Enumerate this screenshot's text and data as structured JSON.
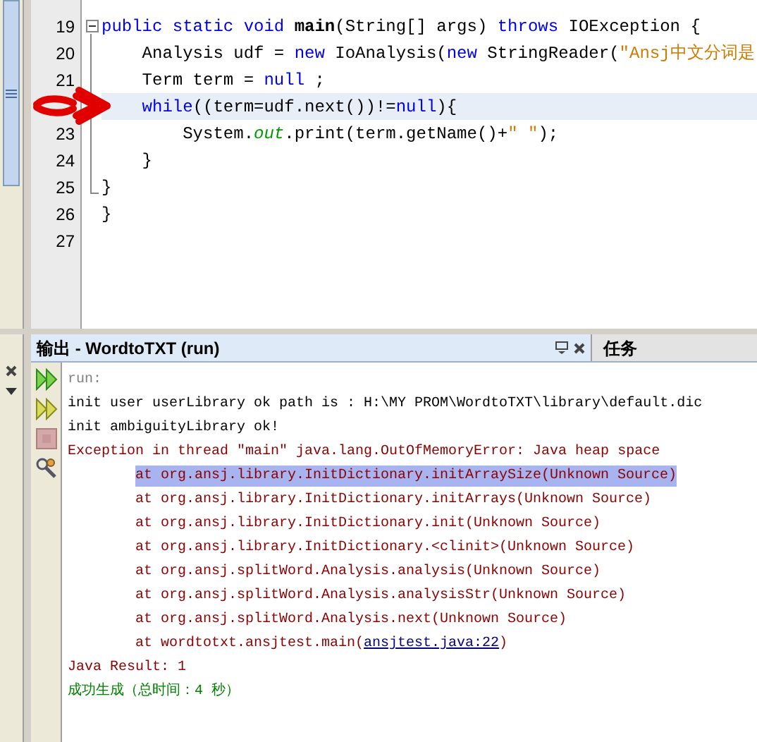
{
  "editor": {
    "lines": [
      {
        "number": "19",
        "collapsed_marker": true,
        "highlighted": false,
        "tokens": [
          {
            "kind": "keyword",
            "text": "public static void "
          },
          {
            "kind": "bold",
            "text": "main"
          },
          {
            "kind": "plain",
            "text": "(String[] args) "
          },
          {
            "kind": "keyword",
            "text": "throws"
          },
          {
            "kind": "plain",
            "text": " IOException {"
          }
        ]
      },
      {
        "number": "20",
        "collapsed_marker": false,
        "highlighted": false,
        "tokens": [
          {
            "kind": "plain",
            "text": "    Analysis udf = "
          },
          {
            "kind": "keyword",
            "text": "new"
          },
          {
            "kind": "plain",
            "text": " IoAnalysis("
          },
          {
            "kind": "keyword",
            "text": "new"
          },
          {
            "kind": "plain",
            "text": " StringReader("
          },
          {
            "kind": "string",
            "text": "\"Ansj中文分词是"
          }
        ]
      },
      {
        "number": "21",
        "collapsed_marker": false,
        "highlighted": false,
        "tokens": [
          {
            "kind": "plain",
            "text": "    Term term = "
          },
          {
            "kind": "keyword",
            "text": "null"
          },
          {
            "kind": "plain",
            "text": " ;"
          }
        ]
      },
      {
        "collapsed_marker": false,
        "highlighted": true,
        "tokens": [
          {
            "kind": "keyword",
            "text": "    while"
          },
          {
            "kind": "plain",
            "text": "((term=udf.next())!="
          },
          {
            "kind": "keyword",
            "text": "null"
          },
          {
            "kind": "plain",
            "text": "){"
          }
        ]
      },
      {
        "number": "23",
        "collapsed_marker": false,
        "highlighted": false,
        "tokens": [
          {
            "kind": "plain",
            "text": "        System."
          },
          {
            "kind": "field",
            "text": "out"
          },
          {
            "kind": "plain",
            "text": ".print(term.getName()+"
          },
          {
            "kind": "string",
            "text": "\" \""
          },
          {
            "kind": "plain",
            "text": ");"
          }
        ]
      },
      {
        "number": "24",
        "collapsed_marker": false,
        "highlighted": false,
        "tokens": [
          {
            "kind": "plain",
            "text": "    }"
          }
        ]
      },
      {
        "number": "25",
        "collapsed_marker": false,
        "highlighted": false,
        "tokens": [
          {
            "kind": "plain",
            "text": "}"
          }
        ]
      },
      {
        "number": "26",
        "collapsed_marker": false,
        "highlighted": false,
        "tokens": [
          {
            "kind": "plain",
            "text": "}"
          }
        ]
      },
      {
        "number": "27",
        "collapsed_marker": false,
        "highlighted": false
      }
    ]
  },
  "output_panel": {
    "title": "输出 - WordtoTXT (run)",
    "side_tab": "任务",
    "lines": [
      {
        "kind": "muted",
        "indented": false,
        "selected": false,
        "segments": [
          {
            "text": "run:",
            "link": false
          }
        ]
      },
      {
        "kind": "normal",
        "indented": false,
        "selected": false,
        "segments": [
          {
            "text": "init user userLibrary ok path is : H:\\MY PROM\\WordtoTXT\\library\\default.dic",
            "link": false
          }
        ]
      },
      {
        "kind": "normal",
        "indented": false,
        "selected": false,
        "segments": [
          {
            "text": "init ambiguityLibrary ok!",
            "link": false
          }
        ]
      },
      {
        "kind": "error",
        "indented": false,
        "selected": false,
        "segments": [
          {
            "text": "Exception in thread \"main\" java.lang.OutOfMemoryError: Java heap space",
            "link": false
          }
        ]
      },
      {
        "kind": "error",
        "indented": true,
        "selected": true,
        "segments": [
          {
            "text": "at org.ansj.library.InitDictionary.initArraySize(Unknown Source)",
            "link": false
          }
        ]
      },
      {
        "kind": "error",
        "indented": true,
        "selected": false,
        "segments": [
          {
            "text": "at org.ansj.library.InitDictionary.initArrays(Unknown Source)",
            "link": false
          }
        ]
      },
      {
        "kind": "error",
        "indented": true,
        "selected": false,
        "segments": [
          {
            "text": "at org.ansj.library.InitDictionary.init(Unknown Source)",
            "link": false
          }
        ]
      },
      {
        "kind": "error",
        "indented": true,
        "selected": false,
        "segments": [
          {
            "text": "at org.ansj.library.InitDictionary.<clinit>(Unknown Source)",
            "link": false
          }
        ]
      },
      {
        "kind": "error",
        "indented": true,
        "selected": false,
        "segments": [
          {
            "text": "at org.ansj.splitWord.Analysis.analysis(Unknown Source)",
            "link": false
          }
        ]
      },
      {
        "kind": "error",
        "indented": true,
        "selected": false,
        "segments": [
          {
            "text": "at org.ansj.splitWord.Analysis.analysisStr(Unknown Source)",
            "link": false
          }
        ]
      },
      {
        "kind": "error",
        "indented": true,
        "selected": false,
        "segments": [
          {
            "text": "at org.ansj.splitWord.Analysis.next(Unknown Source)",
            "link": false
          }
        ]
      },
      {
        "kind": "error",
        "indented": true,
        "selected": false,
        "segments": [
          {
            "text": "at wordtotxt.ansjtest.main(",
            "link": false
          },
          {
            "text": "ansjtest.java:22",
            "link": true
          },
          {
            "text": ")",
            "link": false
          }
        ]
      },
      {
        "kind": "error",
        "indented": false,
        "selected": false,
        "segments": [
          {
            "text": "Java Result: 1",
            "link": false
          }
        ]
      },
      {
        "kind": "success",
        "indented": false,
        "selected": false,
        "segments": [
          {
            "text": "成功生成（总时间：4 秒）",
            "link": false
          }
        ]
      }
    ]
  }
}
